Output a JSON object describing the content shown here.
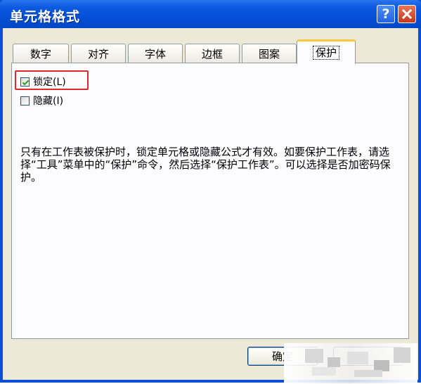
{
  "window": {
    "title": "单元格格式",
    "help_glyph": "?"
  },
  "tabs": [
    {
      "label": "数字",
      "active": false
    },
    {
      "label": "对齐",
      "active": false
    },
    {
      "label": "字体",
      "active": false
    },
    {
      "label": "边框",
      "active": false
    },
    {
      "label": "图案",
      "active": false
    },
    {
      "label": "保护",
      "active": true
    }
  ],
  "protection": {
    "locked": {
      "label": "锁定(L)",
      "checked": true
    },
    "hidden": {
      "label": "隐藏(I)",
      "checked": false
    },
    "description": "只有在工作表被保护时，锁定单元格或隐藏公式才有效。如要保护工作表，请选择“工具”菜单中的“保护”命令，然后选择“保护工作表”。可以选择是否加密码保护。"
  },
  "buttons": {
    "ok_label": "确定"
  },
  "colors": {
    "titlebar": "#0550d8",
    "dialog_bg": "#ece9d8",
    "highlight_box": "#e0282a",
    "active_tab_accent": "#ffc83c"
  },
  "icons": {
    "help": "help-icon",
    "close": "close-icon",
    "check": "checkmark-icon"
  }
}
